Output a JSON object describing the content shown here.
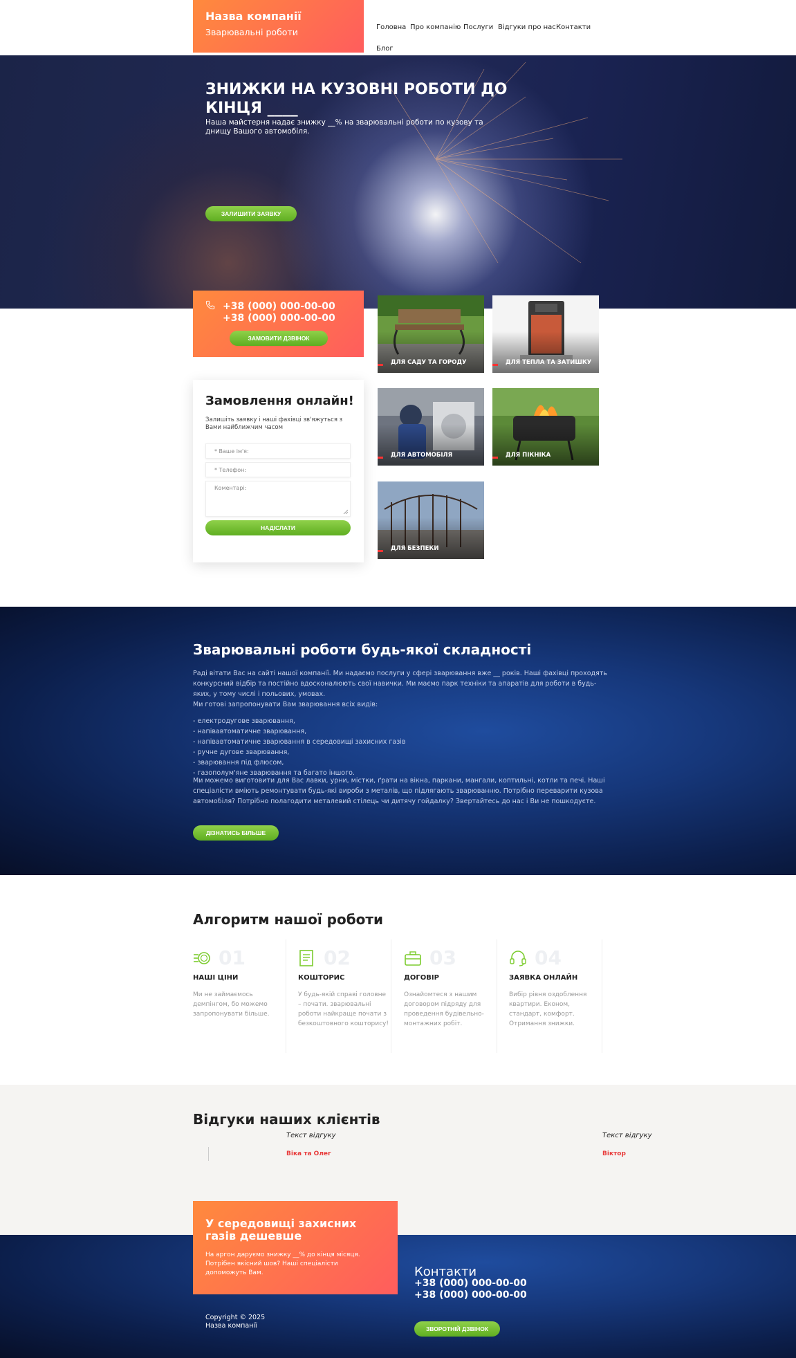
{
  "header": {
    "company_name": "Назва компанії",
    "company_tagline": "Зварювальні роботи",
    "nav": [
      "Головна",
      "Про компанію",
      "Послуги",
      "Відгуки про нас",
      "Контакти",
      "Блог"
    ]
  },
  "hero": {
    "title": "ЗНИЖКИ НА КУЗОВНІ РОБОТИ ДО КІНЦЯ ____",
    "text": "Наша майстерня надає знижку __% на зварювальні роботи по кузову та днищу Вашого автомобіля.",
    "button": "ЗАЛИШИТИ ЗАЯВКУ"
  },
  "phone_card": {
    "phone1": "+38 (000) 000-00-00",
    "phone2": "+38 (000) 000-00-00",
    "button": "ЗАМОВИТИ ДЗВІНОК"
  },
  "order_form": {
    "title": "Замовлення онлайн!",
    "subtitle": "Залишіть заявку і наші фахівці зв'яжуться з Вами найближчим часом",
    "name_placeholder": "* Ваше ім'я:",
    "phone_placeholder": "* Телефон:",
    "comment_placeholder": "Коментарі:",
    "submit": "НАДІСЛАТИ"
  },
  "products": [
    {
      "label": "ДЛЯ САДУ ТА ГОРОДУ"
    },
    {
      "label": "ДЛЯ ТЕПЛА ТА ЗАТИШКУ"
    },
    {
      "label": "ДЛЯ АВТОМОБІЛЯ"
    },
    {
      "label": "ДЛЯ ПІКНІКА"
    },
    {
      "label": "ДЛЯ БЕЗПЕКИ"
    }
  ],
  "about": {
    "title": "Зварювальні роботи будь-якої складності",
    "para1": "Раді вітати Вас на сайті нашої компанії. Ми надаємо послуги у сфері зварювання вже __ років. Наші фахівці проходять конкурсний відбір та постійно вдосконалюють свої навички. Ми маємо парк техніки та апаратів для роботи в будь-яких, у тому числі і польових, умовах.",
    "para2": "Ми готові запропонувати Вам зварювання всіх видів:",
    "list": [
      "- електродугове зварювання,",
      "- напівавтоматичне зварювання,",
      "- напівавтоматичне зварювання в середовищі захисних газів",
      "- ручне дугове зварювання,",
      "- зварювання під флюсом,",
      "- газополум'яне зварювання та багато іншого."
    ],
    "para3": "Ми можемо виготовити для Вас лавки, урни, містки, ґрати на вікна, паркани, мангали, коптильні, котли та печі. Наші спеціалісти вміють ремонтувати будь-які вироби з металів, що підлягають зварюванню. Потрібно переварити кузова автомобіля? Потрібно полагодити металевий стілець чи дитячу гойдалку? Звертайтесь до нас і Ви не пошкодуєте.",
    "button": "ДІЗНАТИСЬ БІЛЬШЕ"
  },
  "algorithm": {
    "title": "Алгоритм нашої роботи",
    "steps": [
      {
        "num": "01",
        "title": "НАШІ ЦІНИ",
        "text": "Ми не займаємось демпінгом, бо можемо запропонувати більше.",
        "icon": "coins-icon"
      },
      {
        "num": "02",
        "title": "КОШТОРИС",
        "text": "У будь-якій справі головне – почати. зварювальні роботи найкраще почати з безкоштовного кошторису!",
        "icon": "document-icon"
      },
      {
        "num": "03",
        "title": "ДОГОВІР",
        "text": "Ознайомтеся з нашим договором підряду для проведення будівельно-монтажних робіт.",
        "icon": "briefcase-icon"
      },
      {
        "num": "04",
        "title": "ЗАЯВКА ОНЛАЙН",
        "text": "Вибір рівня оздоблення квартири. Економ, стандарт, комфорт. Отримання знижки.",
        "icon": "headset-icon"
      }
    ],
    "accent": "#7ccc2e"
  },
  "reviews": {
    "title": "Відгуки наших клієнтів",
    "items": [
      {
        "text": "Текст відгуку",
        "author": "Віка та Олег"
      },
      {
        "text": "Текст відгуку",
        "author": "Віктор"
      }
    ]
  },
  "promo": {
    "title": "У середовищі захисних газів дешевше",
    "text": "На аргон даруємо знижку __% до кінця місяця. Потрібен якісний шов? Наші спеціалісти допоможуть Вам."
  },
  "footer": {
    "copyright": "Copyright © 2025",
    "company": "Назва компанії",
    "contacts_title": "Контакти",
    "phone1": "+38 (000) 000-00-00",
    "phone2": "+38 (000) 000-00-00",
    "button": "ЗВОРОТНІЙ ДЗВІНОК"
  },
  "colors": {
    "orange_gradient_start": "#ff8a3d",
    "orange_gradient_end": "#ff5d5d",
    "green": "#7ccc2e",
    "review_name": "#e83b3b",
    "dark_blue": "#0c1f4c"
  }
}
